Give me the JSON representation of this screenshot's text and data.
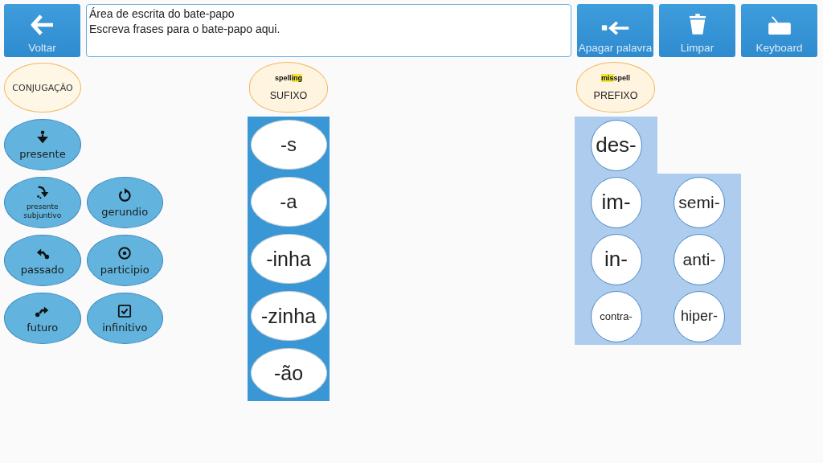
{
  "toolbar": {
    "back": {
      "label": "Voltar"
    },
    "chat_area": {
      "lines": [
        "Área de escrita do bate-papo",
        "Escreva frases para o bate-papo aqui."
      ]
    },
    "buttons": [
      {
        "label": "Apagar palavra"
      },
      {
        "label": "Limpar"
      },
      {
        "label": "Keyboard"
      }
    ]
  },
  "conjugation": {
    "label": "CONJUGAÇÃO",
    "rows": [
      [
        {
          "label": "presente",
          "small": false
        }
      ],
      [
        {
          "label": "presente subjuntivo",
          "small": true
        },
        {
          "label": "gerundio",
          "small": false
        }
      ],
      [
        {
          "label": "passado",
          "small": false
        },
        {
          "label": "participio",
          "small": false
        }
      ],
      [
        {
          "label": "futuro",
          "small": false
        },
        {
          "label": "infinitivo",
          "small": false
        }
      ]
    ]
  },
  "suffix": {
    "sample": [
      {
        "text": "spell",
        "highlight": false
      },
      {
        "text": "ing",
        "highlight": true
      }
    ],
    "label": "SUFIXO",
    "items": [
      "-s",
      "-a",
      "-inha",
      "-zinha",
      "-ão"
    ]
  },
  "prefix": {
    "sample": [
      {
        "text": "mis",
        "highlight": true
      },
      {
        "text": "spell",
        "highlight": false
      }
    ],
    "label": "PREFIXO",
    "rows": [
      [
        "des-"
      ],
      [
        "im-",
        "semi-"
      ],
      [
        "in-",
        "anti-"
      ],
      [
        "contra-",
        "hiper-"
      ]
    ]
  }
}
